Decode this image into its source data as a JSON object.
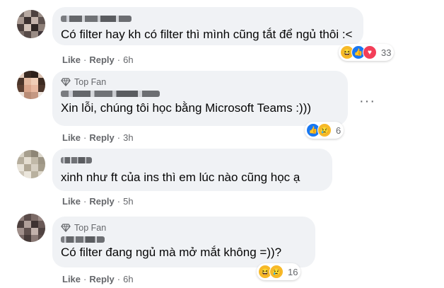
{
  "comments": [
    {
      "top_fan": "",
      "text": "Có filter hay kh có filter thì mình cũng tắt để ngủ thôi :<",
      "actions": {
        "like": "Like",
        "reply": "Reply",
        "time": "6h"
      },
      "reactions": {
        "icons": [
          "haha",
          "like",
          "love"
        ],
        "count": "33"
      }
    },
    {
      "top_fan": "Top Fan",
      "text": "Xin lỗi, chúng tôi học bằng Microsoft Teams :)))",
      "actions": {
        "like": "Like",
        "reply": "Reply",
        "time": "3h"
      },
      "reactions": {
        "icons": [
          "like",
          "sad"
        ],
        "count": "6"
      }
    },
    {
      "top_fan": "",
      "text": "xinh như ft của ins thì em lúc nào cũng học ạ",
      "actions": {
        "like": "Like",
        "reply": "Reply",
        "time": "5h"
      },
      "reactions": null
    },
    {
      "top_fan": "Top Fan",
      "text": "Có filter đang ngủ mà mở mắt không =))?",
      "actions": {
        "like": "Like",
        "reply": "Reply",
        "time": "6h"
      },
      "reactions": {
        "icons": [
          "haha",
          "sad"
        ],
        "count": "16"
      }
    }
  ],
  "more_options": "···",
  "colors": {
    "like": "#1877f2",
    "love": "#f33e58",
    "haha": "#f7b928",
    "bubble": "#f0f2f5",
    "secondary_text": "#65676b"
  }
}
